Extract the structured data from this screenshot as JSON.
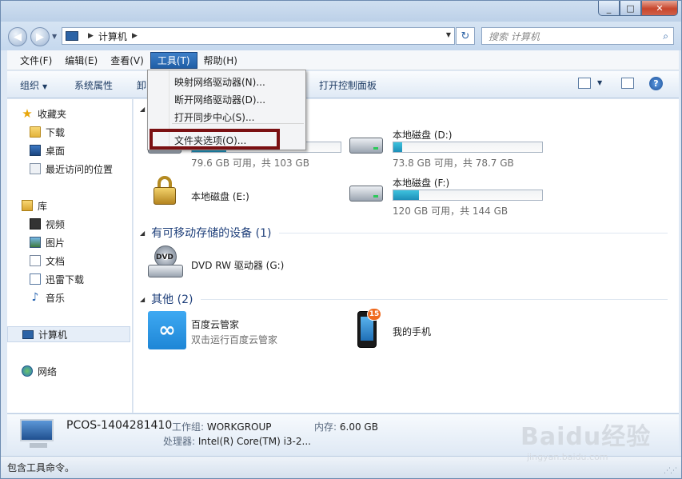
{
  "window": {
    "controls": {
      "min_icon": "_",
      "max_icon": "□",
      "close_icon": "✕"
    }
  },
  "navbar": {
    "back_icon": "◀",
    "forward_icon": "▶",
    "address_crumb": "计算机",
    "refresh_icon": "↻",
    "search_placeholder": "搜索 计算机",
    "search_icon": "⌕"
  },
  "menubar": {
    "items": [
      "文件(F)",
      "编辑(E)",
      "查看(V)",
      "工具(T)",
      "帮助(H)"
    ],
    "active_index": 3
  },
  "cmdbar": {
    "organize": "组织",
    "system_properties": "系统属性",
    "truncated": "卸",
    "control_panel": "打开控制面板",
    "help_icon": "?"
  },
  "sidebar": {
    "favorites": "收藏夹",
    "downloads": "下载",
    "desktop": "桌面",
    "recent": "最近访问的位置",
    "libraries": "库",
    "videos": "视频",
    "pictures": "图片",
    "documents": "文档",
    "xunlei": "迅雷下载",
    "music": "音乐",
    "computer": "计算机",
    "network": "网络"
  },
  "content": {
    "drives": [
      {
        "name": "",
        "size": "79.6 GB 可用，共 103 GB",
        "used_fraction": 0.23
      },
      {
        "name": "本地磁盘 (D:)",
        "size": "73.8 GB 可用，共 78.7 GB",
        "used_fraction": 0.06
      },
      {
        "name": "本地磁盘 (E:)",
        "size": "",
        "used_fraction": 0
      },
      {
        "name": "本地磁盘 (F:)",
        "size": "120 GB 可用，共 144 GB",
        "used_fraction": 0.17
      }
    ],
    "removable_header": "有可移动存储的设备 (1)",
    "dvd_name": "DVD RW 驱动器 (G:)",
    "dvd_label": "DVD",
    "other_header": "其他 (2)",
    "baidu_name": "百度云管家",
    "baidu_sub": "双击运行百度云管家",
    "phone_name": "我的手机",
    "phone_badge": "15"
  },
  "dropdown": {
    "items": [
      "映射网络驱动器(N)...",
      "断开网络驱动器(D)...",
      "打开同步中心(S)...",
      "文件夹选项(O)..."
    ]
  },
  "details": {
    "pc_name": "PCOS-1404281410",
    "workgroup_label": "工作组:",
    "workgroup": "WORKGROUP",
    "memory_label": "内存:",
    "memory": "6.00 GB",
    "cpu_label": "处理器:",
    "cpu": "Intel(R) Core(TM) i3-2..."
  },
  "statusbar": {
    "text": "包含工具命令。"
  },
  "watermark": {
    "logo": "Baidu经验",
    "url": "jingyan.baidu.com"
  },
  "colors": {
    "menu_active": "#2a6db5",
    "highlight_box": "#7a1012",
    "drive_bar": "#26a7cf"
  }
}
